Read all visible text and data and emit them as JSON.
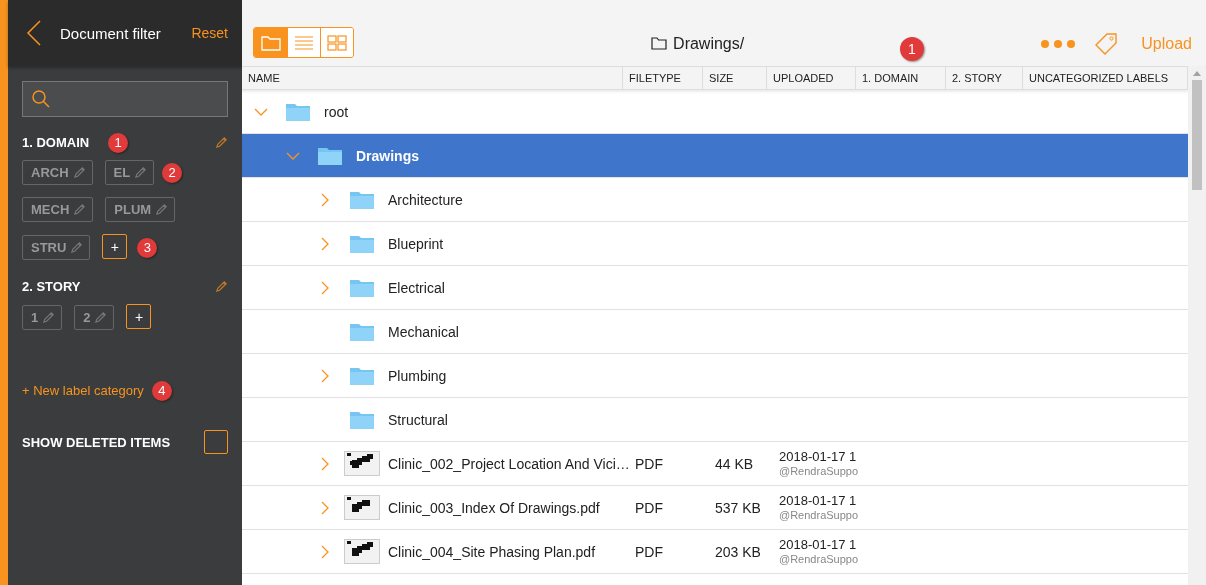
{
  "sidebar": {
    "title": "Document filter",
    "reset": "Reset",
    "categories": [
      {
        "name": "1. DOMAIN",
        "callout": "1",
        "tags": [
          {
            "label": "ARCH"
          },
          {
            "label": "EL",
            "callout": "2"
          },
          {
            "label": "MECH"
          },
          {
            "label": "PLUM"
          },
          {
            "label": "STRU"
          }
        ],
        "add": "+",
        "add_callout": "3"
      },
      {
        "name": "2. STORY",
        "tags": [
          {
            "label": "1"
          },
          {
            "label": "2"
          }
        ],
        "add": "+"
      }
    ],
    "new_category": {
      "label": "+ New label category",
      "callout": "4"
    },
    "show_deleted": {
      "label": "SHOW DELETED ITEMS",
      "checked": false
    }
  },
  "toolbar": {
    "views": [
      {
        "kind": "folder",
        "selected": true
      },
      {
        "kind": "list",
        "selected": false
      },
      {
        "kind": "grid",
        "selected": false
      }
    ],
    "path": "Drawings/",
    "callout": "1",
    "upload": "Upload"
  },
  "table": {
    "columns": [
      "NAME",
      "FILETYPE",
      "SIZE",
      "UPLOADED",
      "1. DOMAIN",
      "2. STORY",
      "UNCATEGORIZED LABELS"
    ],
    "rows": [
      {
        "kind": "folder",
        "name": "root",
        "expanded": true,
        "selected": false,
        "children": [
          {
            "kind": "folder",
            "name": "Drawings",
            "expanded": true,
            "selected": true,
            "children": [
              {
                "kind": "folder",
                "name": "Architecture",
                "expanded": false,
                "selected": false
              },
              {
                "kind": "folder",
                "name": "Blueprint",
                "expanded": false,
                "selected": false
              },
              {
                "kind": "folder",
                "name": "Electrical",
                "expanded": false,
                "selected": false
              },
              {
                "kind": "folder",
                "name": "Mechanical",
                "selected": false
              },
              {
                "kind": "folder",
                "name": "Plumbing",
                "expanded": false,
                "selected": false
              },
              {
                "kind": "folder",
                "name": "Structural",
                "selected": false
              },
              {
                "kind": "file",
                "name": "Clinic_002_Project Location And Vici…",
                "filetype": "PDF",
                "size": "44 KB",
                "uploaded": "2018-01-17 1",
                "uploader": "@RendraSuppo",
                "expanded": false,
                "selected": false
              },
              {
                "kind": "file",
                "name": "Clinic_003_Index Of Drawings.pdf",
                "filetype": "PDF",
                "size": "537 KB",
                "uploaded": "2018-01-17 1",
                "uploader": "@RendraSuppo",
                "expanded": false,
                "selected": false
              },
              {
                "kind": "file",
                "name": "Clinic_004_Site Phasing Plan.pdf",
                "filetype": "PDF",
                "size": "203 KB",
                "uploaded": "2018-01-17 1",
                "uploader": "@RendraSuppo",
                "expanded": false,
                "selected": false
              }
            ]
          }
        ]
      }
    ]
  }
}
